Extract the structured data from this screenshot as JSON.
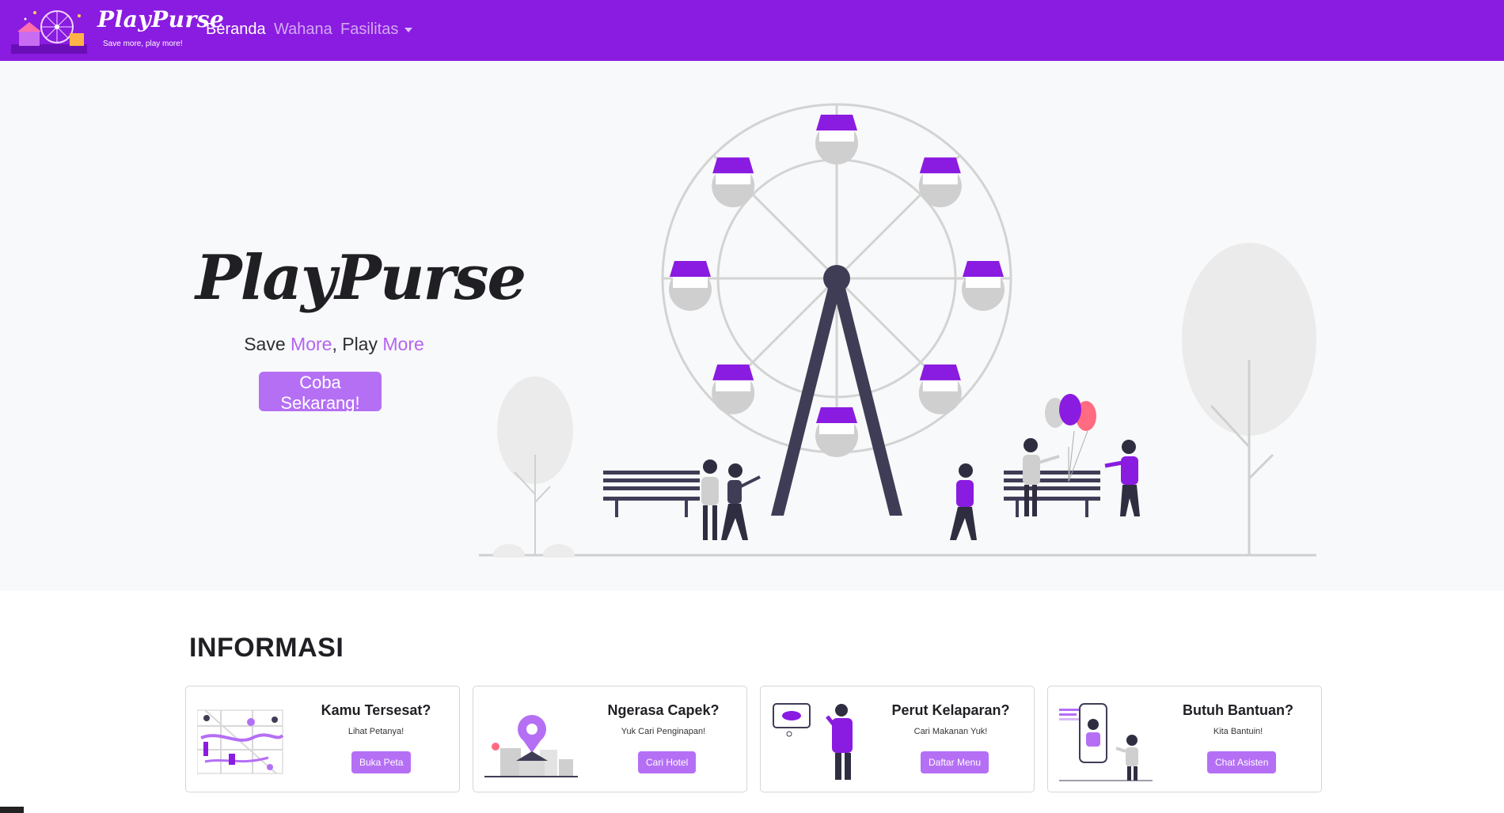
{
  "navbar": {
    "brand": "PlayPurse",
    "tagline": "Save more, play more!",
    "links": [
      "Beranda",
      "Wahana",
      "Fasilitas"
    ]
  },
  "hero": {
    "title": "PlayPurse",
    "subtitle": {
      "p1": "Save ",
      "p2": "More",
      "p3": ", Play ",
      "p4": "More"
    },
    "cta": "Coba Sekarang!"
  },
  "info": {
    "heading": "INFORMASI",
    "cards": [
      {
        "title": "Kamu Tersesat?",
        "text": "Lihat Petanya!",
        "button": "Buka Peta",
        "icon": "map-illustration"
      },
      {
        "title": "Ngerasa Capek?",
        "text": "Yuk Cari Penginapan!",
        "button": "Cari Hotel",
        "icon": "hotel-location-illustration"
      },
      {
        "title": "Perut Kelaparan?",
        "text": "Cari Makanan Yuk!",
        "button": "Daftar Menu",
        "icon": "food-illustration"
      },
      {
        "title": "Butuh Bantuan?",
        "text": "Kita Bantuin!",
        "button": "Chat Asisten",
        "icon": "chat-assistant-illustration"
      }
    ]
  },
  "colors": {
    "primary": "#8a1be0",
    "accent": "#b56ff5",
    "hero_bg": "#f8f9fa"
  }
}
